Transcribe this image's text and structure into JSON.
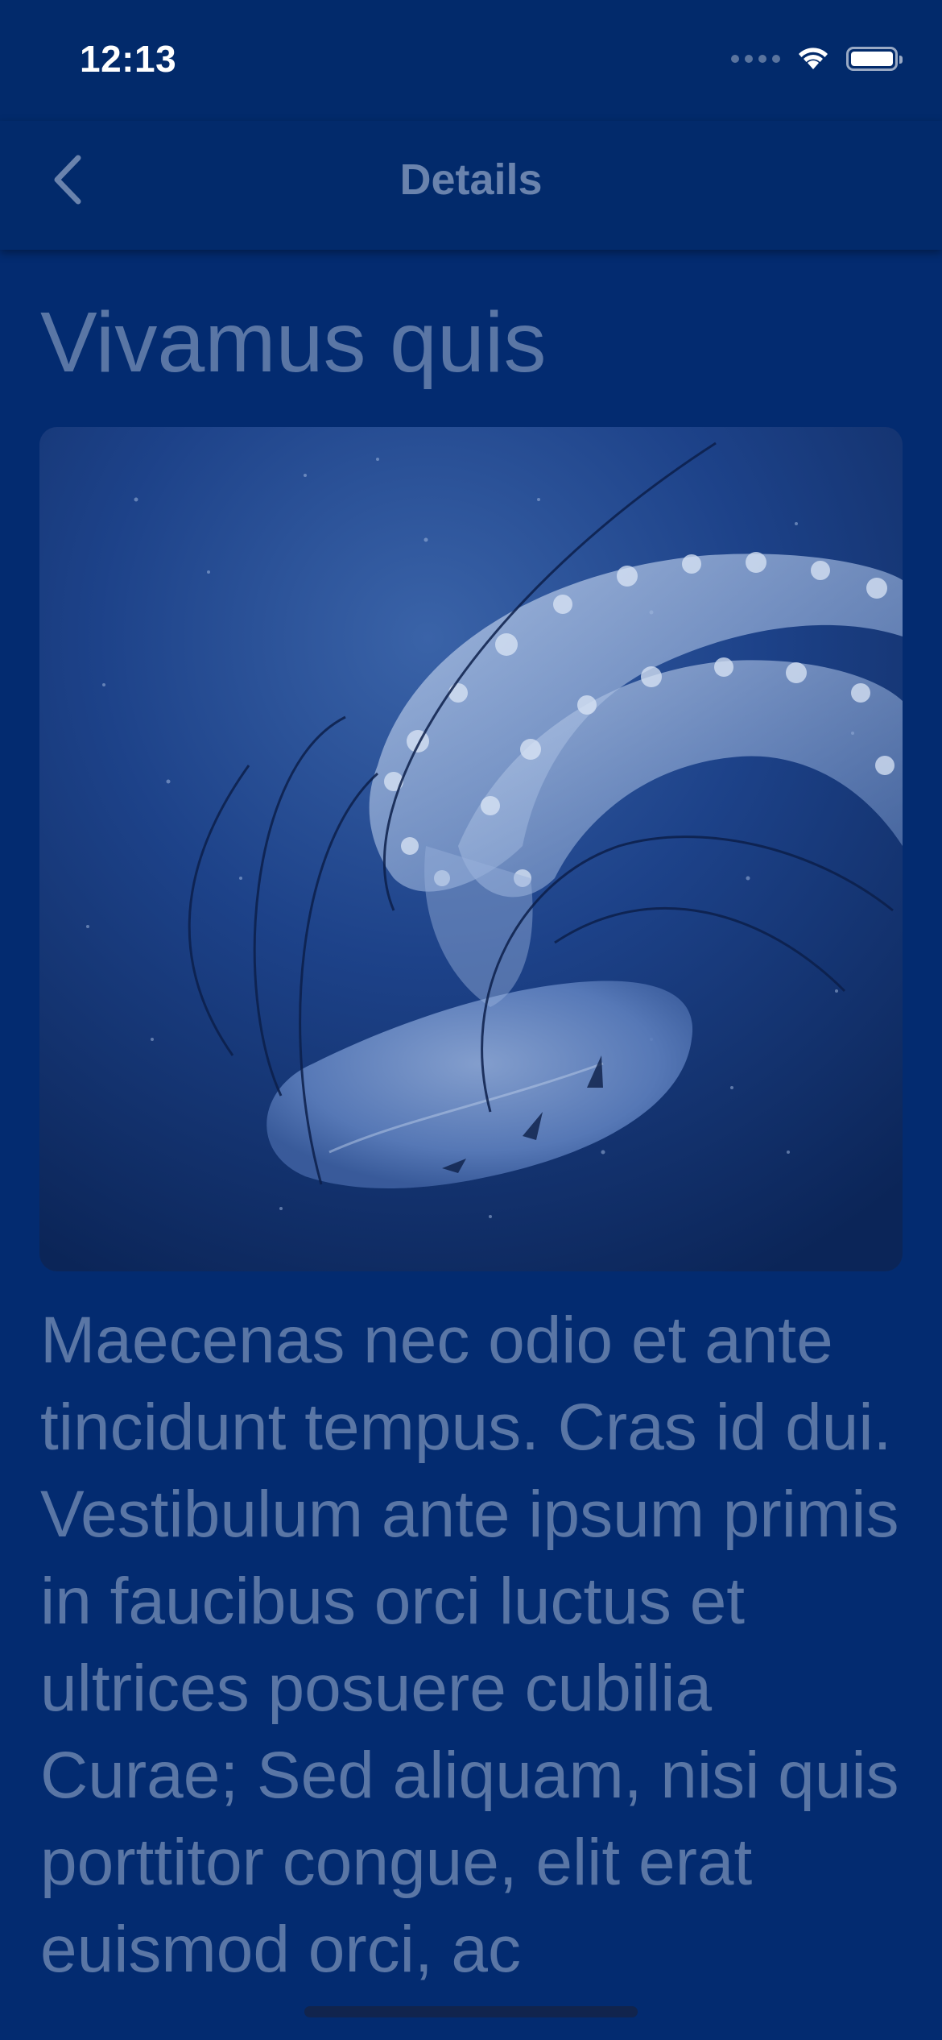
{
  "status_bar": {
    "time": "12:13",
    "icons": [
      "cellular-signal-icon",
      "wifi-icon",
      "battery-icon"
    ]
  },
  "nav": {
    "title": "Details",
    "back_icon": "chevron-left-icon"
  },
  "article": {
    "title": "Vivamus quis",
    "image_subject": "jellyfish",
    "body": "Maecenas nec odio et ante tincidunt tempus. Cras id dui. Vestibulum ante ipsum primis in faucibus orci luctus et ultrices posuere cubilia Curae; Sed aliquam, nisi quis porttitor congue, elit erat euismod orci, ac"
  },
  "colors": {
    "background": "#032b70",
    "bar_background": "#022a6b",
    "text": "#5a76a5",
    "nav_title": "#6a83ad"
  }
}
